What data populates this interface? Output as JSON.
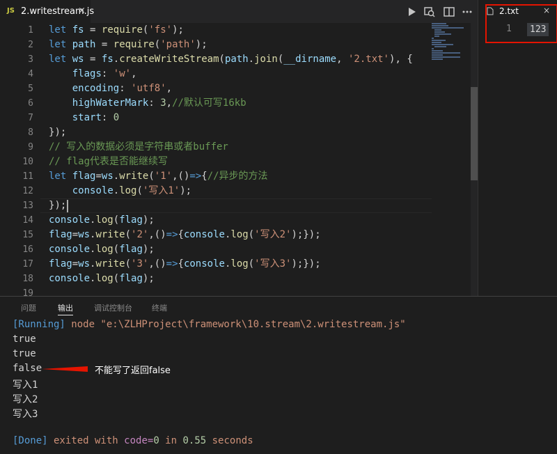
{
  "tabs": {
    "main": {
      "icon": "JS",
      "name": "2.writestream.js",
      "close": "×"
    },
    "secondary": {
      "name": "2.txt",
      "close": "×"
    }
  },
  "toolbar": {
    "icons": [
      "run-icon",
      "debug-search-icon",
      "split-editor-icon",
      "more-actions-icon"
    ]
  },
  "right_pane": {
    "line_number": "1",
    "content": "123"
  },
  "editor": {
    "line_numbers": [
      "1",
      "2",
      "3",
      "4",
      "5",
      "6",
      "7",
      "8",
      "9",
      "10",
      "11",
      "12",
      "13",
      "14",
      "15",
      "16",
      "17",
      "18",
      "19"
    ],
    "lines": [
      "let fs = require('fs');",
      "let path = require('path');",
      "let ws = fs.createWriteStream(path.join(__dirname, '2.txt'), {",
      "    flags: 'w',",
      "    encoding: 'utf8',",
      "    highWaterMark: 3,//默认可写16kb",
      "    start: 0",
      "});",
      "// 写入的数据必须是字符串或者buffer",
      "// flag代表是否能继续写",
      "let flag=ws.write('1',()=>{//异步的方法",
      "    console.log('写入1');",
      "});",
      "console.log(flag);",
      "flag=ws.write('2',()=>{console.log('写入2');});",
      "console.log(flag);",
      "flag=ws.write('3',()=>{console.log('写入3');});",
      "console.log(flag);",
      ""
    ]
  },
  "panel": {
    "tabs": [
      "问题",
      "输出",
      "调试控制台",
      "终端"
    ],
    "active_tab": "输出",
    "output": {
      "running_label": "[Running]",
      "command": " node \"e:\\ZLHProject\\framework\\10.stream\\2.writestream.js\"",
      "lines": [
        "true",
        "true",
        "false",
        "写入1",
        "写入2",
        "写入3"
      ],
      "done_label": "[Done]",
      "done_exited": " exited with ",
      "done_code": "code=",
      "done_code_value": "0",
      "done_in": " in ",
      "done_seconds": "0.55",
      "done_suffix": " seconds"
    },
    "annotation": "不能写了返回false"
  },
  "colors": {
    "accent": "#007acc",
    "highlight_box": "#e51400"
  }
}
